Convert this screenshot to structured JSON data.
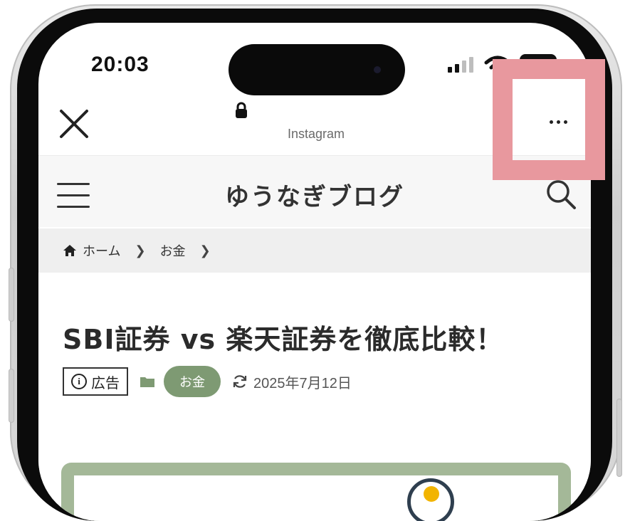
{
  "status_bar": {
    "time": "20:03",
    "icons": [
      "signal-icon",
      "wifi-icon",
      "battery-icon"
    ]
  },
  "browser": {
    "close_icon": "close-icon",
    "lock_icon": "lock-icon",
    "site_name": "Instagram",
    "more_icon": "more-horizontal-icon"
  },
  "site": {
    "title": "ゆうなぎブログ",
    "menu_icon": "hamburger-icon",
    "search_icon": "search-icon"
  },
  "breadcrumb": {
    "home_icon": "home-icon",
    "items": [
      "ホーム",
      "お金"
    ]
  },
  "article": {
    "title": "SBI証券 vs 楽天証券を徹底比較！",
    "ad_label": "広告",
    "category": "お金",
    "updated_date": "2025年7月12日"
  },
  "colors": {
    "accent_green": "#7e9a73",
    "highlight_pink": "#e8989e"
  }
}
